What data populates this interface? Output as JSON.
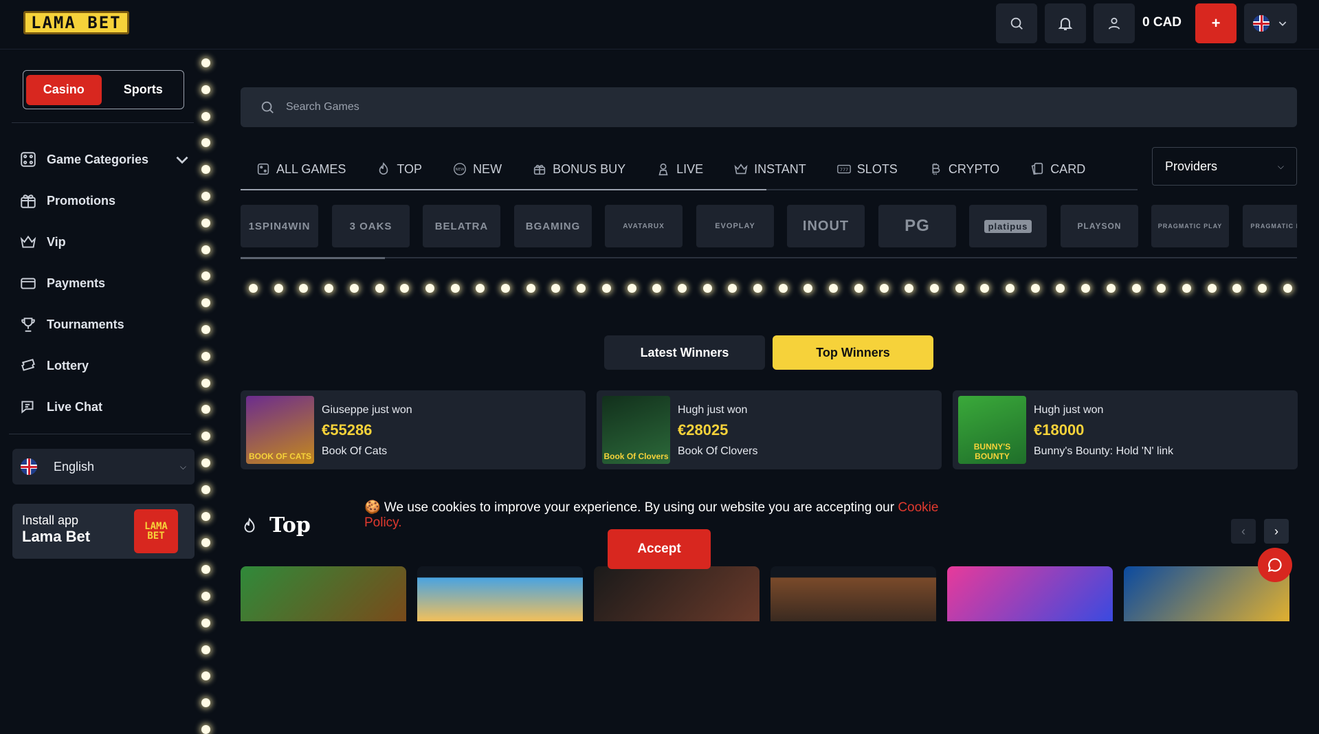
{
  "header": {
    "logo_text": "LAMA BET",
    "balance": "0 CAD",
    "plus_label": "+"
  },
  "sidebar": {
    "toggle": {
      "casino": "Casino",
      "sports": "Sports"
    },
    "items": [
      {
        "label": "Game Categories",
        "icon": "grid-icon"
      },
      {
        "label": "Promotions",
        "icon": "gift-icon"
      },
      {
        "label": "Vip",
        "icon": "crown-icon"
      },
      {
        "label": "Payments",
        "icon": "card-icon"
      },
      {
        "label": "Tournaments",
        "icon": "trophy-icon"
      },
      {
        "label": "Lottery",
        "icon": "ticket-icon"
      },
      {
        "label": "Live Chat",
        "icon": "chat-icon"
      }
    ],
    "language": "English",
    "install": {
      "line1": "Install app",
      "line2": "Lama Bet",
      "logo_top": "LAMA",
      "logo_bottom": "BET"
    }
  },
  "search": {
    "placeholder": "Search Games"
  },
  "categories": {
    "tabs": [
      {
        "label": "ALL GAMES"
      },
      {
        "label": "TOP"
      },
      {
        "label": "NEW"
      },
      {
        "label": "BONUS BUY"
      },
      {
        "label": "LIVE"
      },
      {
        "label": "INSTANT"
      },
      {
        "label": "SLOTS"
      },
      {
        "label": "CRYPTO"
      },
      {
        "label": "CARD"
      }
    ],
    "providers_label": "Providers"
  },
  "providers": [
    "1SPIN4WIN",
    "3 OAKS",
    "BELATRA",
    "BGAMING",
    "AVATARUX",
    "EVOPLAY",
    "INOUT",
    "PG",
    "platipus",
    "PLAYSON",
    "PRAGMATIC PLAY",
    "PRAGMATIC LIVE"
  ],
  "winners": {
    "tabs": {
      "latest": "Latest Winners",
      "top": "Top Winners"
    },
    "cards": [
      {
        "who": "Giuseppe just won",
        "amount": "€55286",
        "game": "Book Of Cats",
        "thumb_text": "BOOK OF CATS",
        "thumb_color": "#6b2c8e"
      },
      {
        "who": "Hugh just won",
        "amount": "€28025",
        "game": "Book Of Clovers",
        "thumb_text": "Book Of Clovers",
        "thumb_color": "#1f4a2a"
      },
      {
        "who": "Hugh just won",
        "amount": "€18000",
        "game": "Bunny's Bounty: Hold 'N' link",
        "thumb_text": "BUNNY'S BOUNTY",
        "thumb_color": "#3aa93a"
      }
    ]
  },
  "top_section": {
    "title": "Top"
  },
  "cookie": {
    "text": "🍪 We use cookies to improve your experience. By using our website you are accepting our",
    "link": "Cookie Policy.",
    "accept": "Accept"
  },
  "colors": {
    "accent_red": "#d8271f",
    "accent_yellow": "#f6d23a",
    "bg": "#0a0f17",
    "panel": "#1d232e"
  }
}
